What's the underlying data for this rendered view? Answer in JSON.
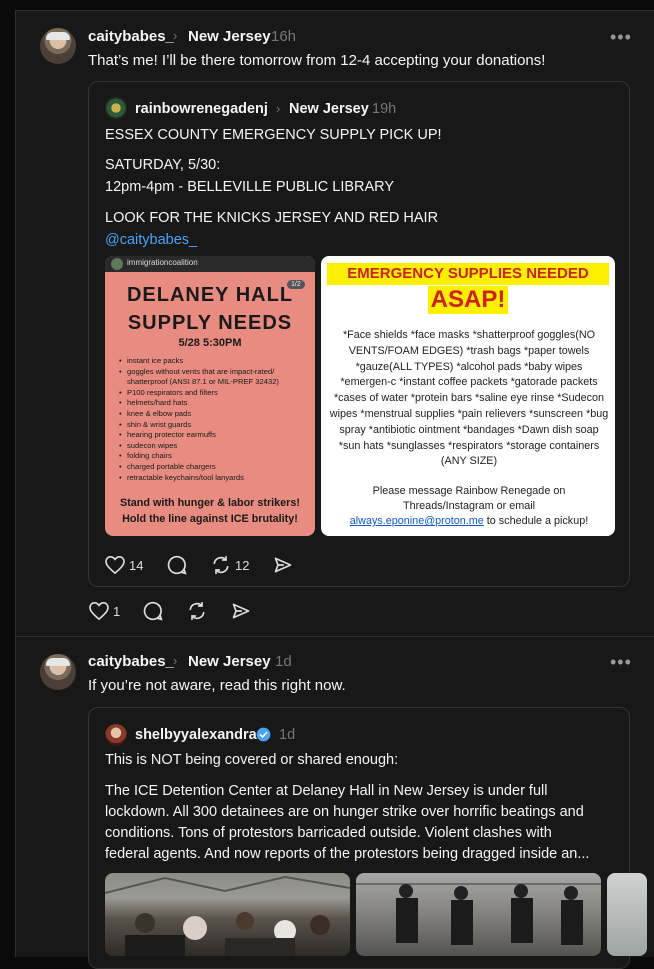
{
  "post1": {
    "username": "caitybabes_",
    "chevron": "›",
    "location": "New Jersey",
    "time": "16h",
    "more": "•••",
    "text": "That’s me! I’ll be there tomorrow from 12-4 accepting your donations!",
    "quote": {
      "username": "rainbowrenegadenj",
      "location": "New Jersey",
      "time": "19h",
      "lines": [
        "ESSEX COUNTY EMERGENCY SUPPLY PICK UP!",
        "SATURDAY, 5/30:",
        "12pm-4pm - BELLEVILLE PUBLIC LIBRARY",
        "LOOK FOR THE KNICKS JERSEY AND RED HAIR"
      ],
      "mention": "@caitybabes_",
      "image1": {
        "header": "immigrationcoalition",
        "page": "1/2",
        "title1": "DELANEY HALL",
        "title2": "SUPPLY NEEDS",
        "date": "5/28 5:30PM",
        "items": [
          "instant ice packs",
          "goggles without vents that are impact-rated/ shatterproof (ANSI 87.1 or MIL-PREF 32432)",
          "P100 respirators and filters",
          "helmets/hard hats",
          "knee & elbow pads",
          "shin & wrist guards",
          "hearing protector earmuffs",
          "sudecon wipes",
          "folding chairs",
          "charged portable chargers",
          "retractable keychains/tool lanyards"
        ],
        "footer1": "Stand with hunger & labor strikers!",
        "footer2": "Hold the line against ICE brutality!"
      },
      "image2": {
        "heading1": "EMERGENCY SUPPLIES NEEDED",
        "heading2": "ASAP!",
        "body": "*Face shields  *face masks  *shatterproof goggles(NO VENTS/FOAM EDGES)  *trash bags  *paper towels  *gauze(ALL TYPES)  *alcohol pads  *baby wipes  *emergen-c  *instant coffee packets  *gatorade packets  *cases of water  *protein bars  *saline eye rinse  *Sudecon wipes  *menstrual supplies  *pain relievers  *sunscreen  *bug spray  *antibiotic ointment  *bandages  *Dawn dish soap  *sun hats  *sunglasses  *respirators  *storage containers (ANY SIZE)",
        "cta1": "Please message Rainbow Renegade on",
        "cta2": "Threads/Instagram or email",
        "email": "always.eponine@proton.me",
        "cta3": " to schedule a pickup!"
      },
      "likes": "14",
      "reposts": "12"
    },
    "likes": "1"
  },
  "post2": {
    "username": "caitybabes_",
    "chevron": "›",
    "location": "New Jersey",
    "time": "1d",
    "more": "•••",
    "text": "If you’re not aware, read this right now.",
    "quote": {
      "username": "shelbyyalexandra",
      "time": "1d",
      "line1": "This is NOT being covered or shared enough:",
      "para": [
        "The ICE Detention Center at Delaney Hall in New Jersey is under full",
        "lockdown. All 300 detainees are on hunger strike over horrific beatings and",
        "conditions. Tons of protestors barricaded outside. Violent clashes with",
        "federal agents. And now reports of the protestors being dragged inside an..."
      ]
    }
  },
  "colors": {
    "background": "#181818",
    "text": "#f3f5f7",
    "muted": "#777777",
    "link": "#4aa3f5",
    "verified": "#4aa3f5"
  }
}
